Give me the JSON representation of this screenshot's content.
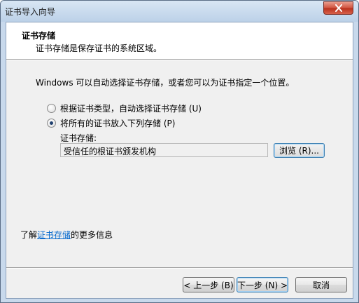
{
  "window": {
    "title": "证书导入向导",
    "close_icon": "close-icon"
  },
  "header": {
    "title": "证书存储",
    "subtitle": "证书存储是保存证书的系统区域。"
  },
  "intro_text": "Windows 可以自动选择证书存储，或者您可以为证书指定一个位置。",
  "options": [
    {
      "label": "根据证书类型，自动选择证书存储 (U)",
      "checked": false
    },
    {
      "label": "将所有的证书放入下列存储 (P)",
      "checked": true
    }
  ],
  "store": {
    "label": "证书存储:",
    "value": "受信任的根证书颁发机构",
    "browse_label": "浏览 (R)..."
  },
  "more_info": {
    "prefix": "了解",
    "link": "证书存储",
    "suffix": "的更多信息"
  },
  "buttons": {
    "back": "< 上一步 (B)",
    "next": "下一步 (N) >",
    "cancel": "取消"
  }
}
